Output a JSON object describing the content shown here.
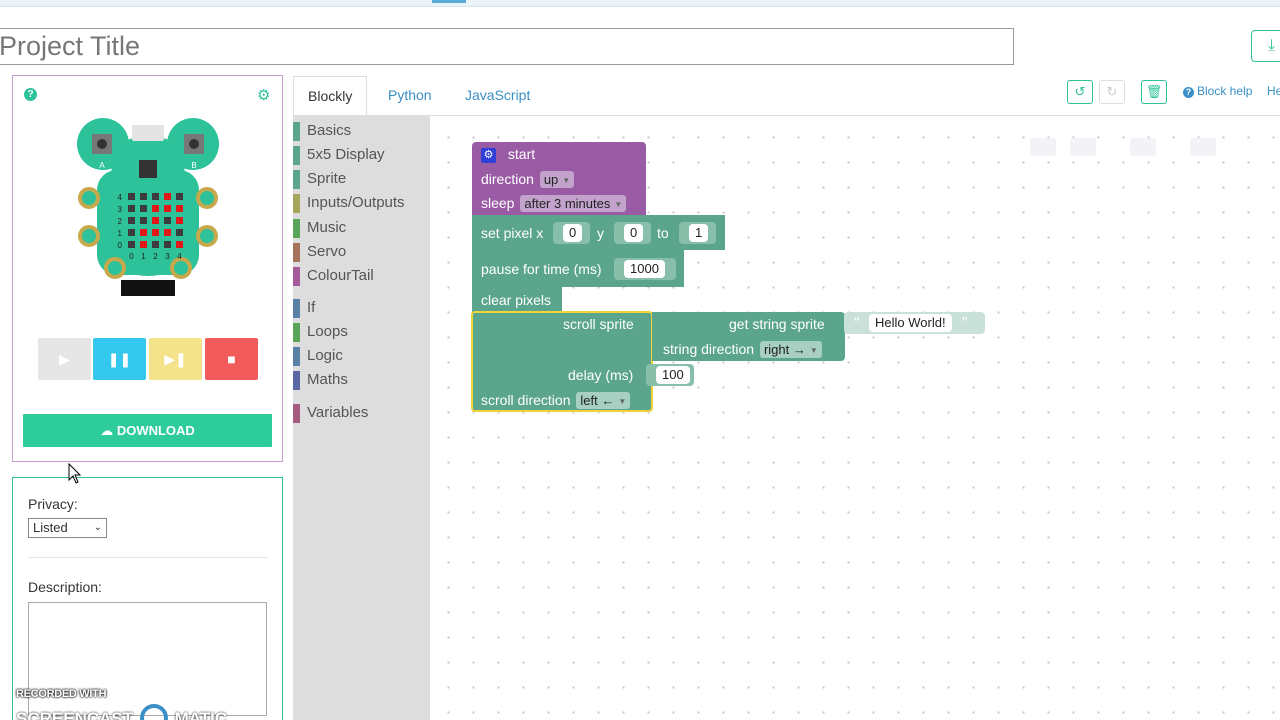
{
  "project": {
    "title": "Project Title"
  },
  "simulator": {
    "row_labels": [
      "4",
      "3",
      "2",
      "1",
      "0"
    ],
    "col_labels": [
      "0",
      "1",
      "2",
      "3",
      "4"
    ],
    "button_a": "A",
    "button_b": "B",
    "lit_pixels": [
      [
        1,
        3
      ],
      [
        2,
        2
      ],
      [
        2,
        3
      ],
      [
        2,
        4
      ],
      [
        3,
        2
      ],
      [
        3,
        4
      ],
      [
        4,
        1
      ],
      [
        4,
        2
      ],
      [
        4,
        3
      ],
      [
        5,
        1
      ],
      [
        5,
        4
      ]
    ],
    "controls": [
      {
        "name": "play",
        "icon": "play-icon",
        "color": "#e6e6e6",
        "glyph": "▶"
      },
      {
        "name": "pause",
        "icon": "pause-icon",
        "color": "#34c8ee",
        "glyph": "❚❚"
      },
      {
        "name": "step",
        "icon": "step-icon",
        "color": "#f4e38a",
        "glyph": "▶❚"
      },
      {
        "name": "stop",
        "icon": "stop-icon",
        "color": "#f25b5b",
        "glyph": "■"
      }
    ],
    "download_label": "DOWNLOAD",
    "download_icon": "cloud-download-icon"
  },
  "meta": {
    "privacy_label": "Privacy:",
    "privacy_value": "Listed",
    "description_label": "Description:"
  },
  "watermark": {
    "line1": "RECORDED WITH",
    "line2": "SCREENCAST",
    "line3": "MATIC"
  },
  "tabs": [
    {
      "label": "Blockly",
      "active": true
    },
    {
      "label": "Python",
      "active": false
    },
    {
      "label": "JavaScript",
      "active": false
    }
  ],
  "toolbar": {
    "undo_icon": "undo-icon",
    "redo_icon": "redo-icon",
    "trash_icon": "trash-icon",
    "block_help": "Block help",
    "help_partial": "He"
  },
  "toolbox": [
    {
      "label": "Basics",
      "color": "#5ba58c"
    },
    {
      "label": "5x5 Display",
      "color": "#5ba58c"
    },
    {
      "label": "Sprite",
      "color": "#5ba58c"
    },
    {
      "label": "Inputs/Outputs",
      "color": "#a5a55b"
    },
    {
      "label": "Music",
      "color": "#5ba55b"
    },
    {
      "label": "Servo",
      "color": "#a5745b"
    },
    {
      "label": "ColourTail",
      "color": "#a55b99"
    },
    {
      "label": "If",
      "color": "#5b80a5"
    },
    {
      "label": "Loops",
      "color": "#5ba55b"
    },
    {
      "label": "Logic",
      "color": "#5b80a5"
    },
    {
      "label": "Maths",
      "color": "#5b67a5"
    },
    {
      "label": "Variables",
      "color": "#a55b80"
    }
  ],
  "blocks": {
    "start": {
      "label": "start",
      "direction_label": "direction",
      "direction_value": "up",
      "sleep_label": "sleep",
      "sleep_value": "after 3 minutes",
      "color": "#9a5ba5"
    },
    "set_pixel": {
      "label": "set pixel x",
      "x": "0",
      "y_label": "y",
      "y": "0",
      "to_label": "to",
      "to": "1"
    },
    "pause": {
      "label": "pause for time (ms)",
      "value": "1000"
    },
    "clear": {
      "label": "clear pixels"
    },
    "scroll": {
      "label": "scroll sprite",
      "delay_label": "delay (ms)",
      "delay": "100",
      "dir_label": "scroll direction",
      "dir_value": "left ←"
    },
    "get_string": {
      "label": "get string sprite",
      "text": "Hello World!",
      "dir_label": "string direction",
      "dir_value": "right →"
    },
    "sprite_color": "#5ba58c"
  }
}
